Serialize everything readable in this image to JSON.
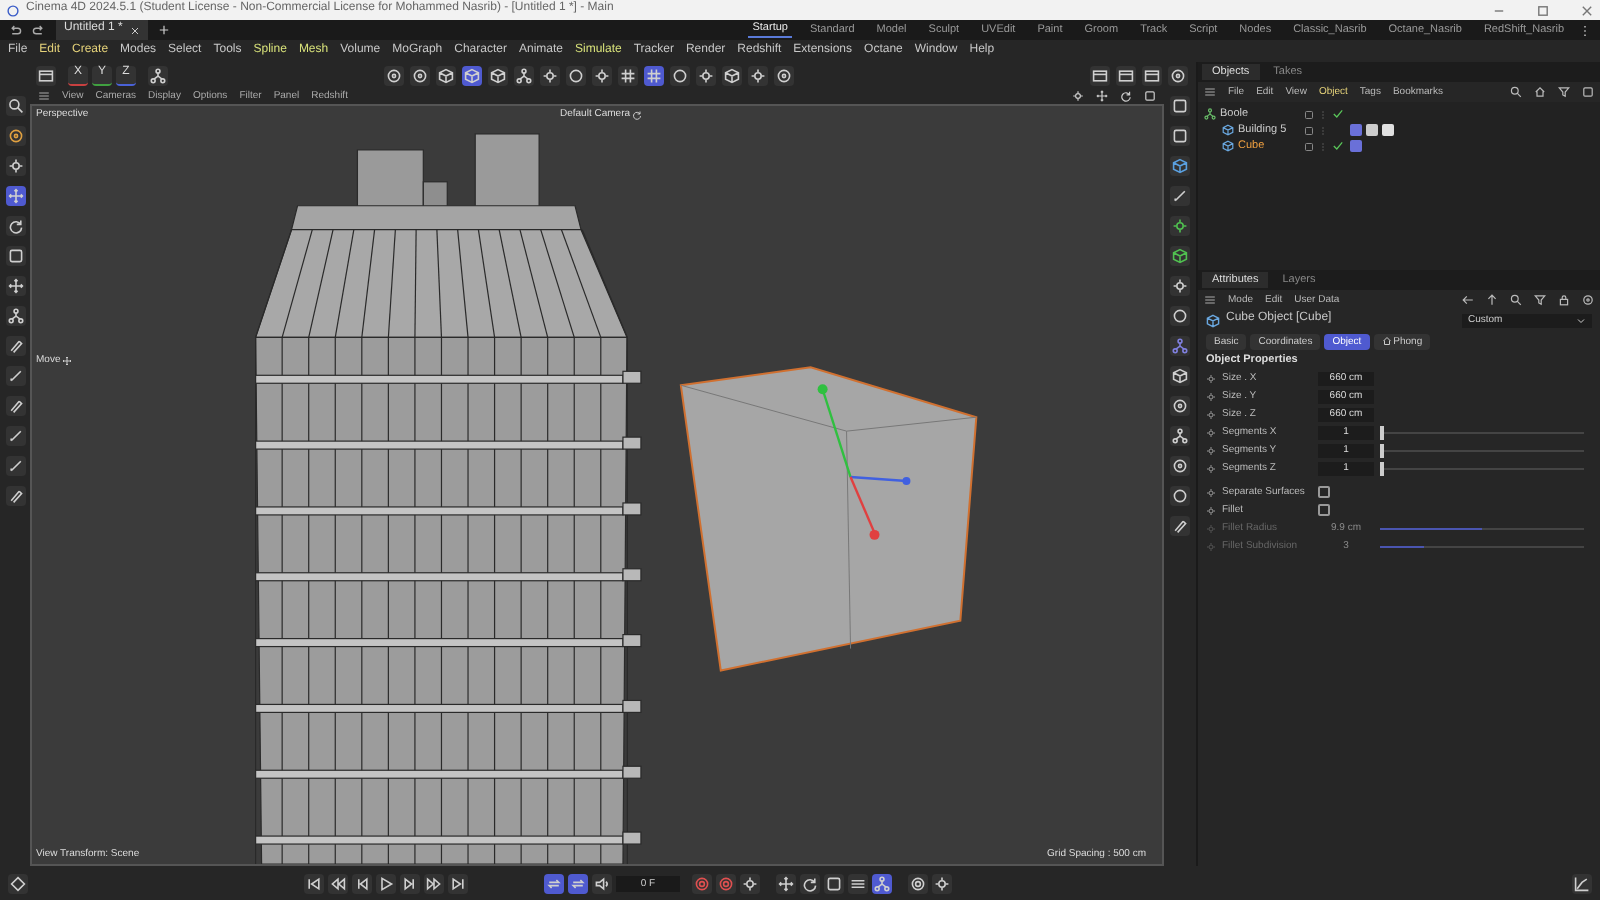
{
  "window": {
    "title": "Cinema 4D 2024.5.1 (Student License - Non-Commercial License for Mohammed Nasrib) - [Untitled 1 *] - Main"
  },
  "document_tabs": [
    {
      "label": "Untitled 1 *",
      "selected": true
    }
  ],
  "layouts": [
    {
      "label": "Startup",
      "selected": true
    },
    {
      "label": "Standard",
      "selected": false
    },
    {
      "label": "Model",
      "selected": false
    },
    {
      "label": "Sculpt",
      "selected": false
    },
    {
      "label": "UVEdit",
      "selected": false
    },
    {
      "label": "Paint",
      "selected": false
    },
    {
      "label": "Groom",
      "selected": false
    },
    {
      "label": "Track",
      "selected": false
    },
    {
      "label": "Script",
      "selected": false
    },
    {
      "label": "Nodes",
      "selected": false
    },
    {
      "label": "Classic_Nasrib",
      "selected": false
    },
    {
      "label": "Octane_Nasrib",
      "selected": false
    },
    {
      "label": "RedShift_Nasrib",
      "selected": false
    }
  ],
  "menu": [
    {
      "label": "File",
      "color": "#c8c8c8"
    },
    {
      "label": "Edit",
      "color": "#e6d37a"
    },
    {
      "label": "Create",
      "color": "#e6d37a"
    },
    {
      "label": "Modes",
      "color": "#c8c8c8"
    },
    {
      "label": "Select",
      "color": "#c8c8c8"
    },
    {
      "label": "Tools",
      "color": "#c8c8c8"
    },
    {
      "label": "Spline",
      "color": "#d8e27a"
    },
    {
      "label": "Mesh",
      "color": "#d8e27a"
    },
    {
      "label": "Volume",
      "color": "#c8c8c8"
    },
    {
      "label": "MoGraph",
      "color": "#c8c8c8"
    },
    {
      "label": "Character",
      "color": "#c8c8c8"
    },
    {
      "label": "Animate",
      "color": "#c8c8c8"
    },
    {
      "label": "Simulate",
      "color": "#d8e27a"
    },
    {
      "label": "Tracker",
      "color": "#c8c8c8"
    },
    {
      "label": "Render",
      "color": "#c8c8c8"
    },
    {
      "label": "Redshift",
      "color": "#c8c8c8"
    },
    {
      "label": "Extensions",
      "color": "#c8c8c8"
    },
    {
      "label": "Octane",
      "color": "#c8c8c8"
    },
    {
      "label": "Window",
      "color": "#c8c8c8"
    },
    {
      "label": "Help",
      "color": "#c8c8c8"
    }
  ],
  "toolbar": {
    "axes": [
      {
        "label": "X",
        "color": "#c84040"
      },
      {
        "label": "Y",
        "color": "#40a040"
      },
      {
        "label": "Z",
        "color": "#4a62d8"
      }
    ],
    "groups": [
      {
        "buttons": [
          {
            "active": false
          }
        ]
      },
      {
        "buttons": [
          {
            "active": false
          }
        ]
      },
      {
        "buttons": [
          {
            "active": false
          },
          {
            "active": false
          },
          {
            "active": false
          },
          {
            "active": true
          },
          {
            "active": false
          },
          {
            "active": false
          },
          {
            "active": false
          },
          {
            "active": false
          },
          {
            "active": false
          },
          {
            "active": false
          },
          {
            "active": true
          },
          {
            "active": false
          },
          {
            "active": false
          },
          {
            "active": false
          },
          {
            "active": false
          },
          {
            "active": false
          }
        ]
      },
      {
        "buttons": [
          {
            "active": false
          },
          {
            "active": false
          },
          {
            "active": false
          },
          {
            "active": false
          }
        ]
      }
    ]
  },
  "left_tools": [
    {
      "active": false
    },
    {
      "active": false
    },
    {
      "active": false
    },
    {
      "active": true
    },
    {
      "active": false
    },
    {
      "active": false
    },
    {
      "active": false
    },
    {
      "active": false
    },
    {
      "active": false
    },
    {
      "active": false
    },
    {
      "active": false
    },
    {
      "active": false
    },
    {
      "active": false
    },
    {
      "active": false
    }
  ],
  "viewport": {
    "menu": [
      "View",
      "Cameras",
      "Display",
      "Options",
      "Filter",
      "Panel",
      "Redshift"
    ],
    "view_name": "Perspective",
    "camera": "Default Camera",
    "tool": "Move",
    "view_transform": "View Transform: Scene",
    "grid_spacing": "Grid Spacing : 500 cm"
  },
  "right_strip": [
    {
      "active": false
    },
    {
      "active": false
    },
    {
      "active": false
    },
    {
      "active": false
    },
    {
      "active": false
    },
    {
      "active": false
    },
    {
      "active": false
    },
    {
      "active": false
    },
    {
      "active": false
    },
    {
      "active": false
    },
    {
      "active": false
    },
    {
      "active": false
    },
    {
      "active": false
    },
    {
      "active": false
    },
    {
      "active": false
    }
  ],
  "objects_panel": {
    "tabs": [
      {
        "label": "Objects",
        "selected": true
      },
      {
        "label": "Takes",
        "selected": false
      }
    ],
    "menu": [
      {
        "label": "File",
        "selected": false
      },
      {
        "label": "Edit",
        "selected": false
      },
      {
        "label": "View",
        "selected": false
      },
      {
        "label": "Object",
        "selected": true
      },
      {
        "label": "Tags",
        "selected": false
      },
      {
        "label": "Bookmarks",
        "selected": false
      }
    ],
    "tree": [
      {
        "name": "Boole",
        "selected": false,
        "checked": true,
        "children": [
          {
            "name": "Building 5",
            "selected": false,
            "checked": false,
            "tags": [
              {
                "kind": "phong"
              },
              {
                "kind": "uvw"
              },
              {
                "kind": "material"
              }
            ]
          },
          {
            "name": "Cube",
            "selected": true,
            "checked": true,
            "tags": [
              {
                "kind": "phong"
              }
            ]
          }
        ]
      }
    ]
  },
  "attributes_panel": {
    "tabs": [
      {
        "label": "Attributes",
        "selected": true
      },
      {
        "label": "Layers",
        "selected": false
      }
    ],
    "menu": [
      "Mode",
      "Edit",
      "User Data"
    ],
    "object_title": "Cube Object [Cube]",
    "preset": "Custom",
    "sub_tabs": [
      {
        "label": "Basic",
        "selected": false
      },
      {
        "label": "Coordinates",
        "selected": false
      },
      {
        "label": "Object",
        "selected": true
      },
      {
        "label": "Phong",
        "selected": false
      }
    ],
    "section": "Object Properties",
    "fields": [
      {
        "kind": "number",
        "label": "Size . X",
        "value": "660 cm",
        "disabled": false
      },
      {
        "kind": "number",
        "label": "Size . Y",
        "value": "660 cm",
        "disabled": false
      },
      {
        "kind": "number",
        "label": "Size . Z",
        "value": "660 cm",
        "disabled": false
      },
      {
        "kind": "slider",
        "label": "Segments X",
        "value": "1",
        "level": 0,
        "disabled": false
      },
      {
        "kind": "slider",
        "label": "Segments Y",
        "value": "1",
        "level": 0,
        "disabled": false
      },
      {
        "kind": "slider",
        "label": "Segments Z",
        "value": "1",
        "level": 0,
        "disabled": false
      },
      {
        "kind": "checkbox",
        "label": "Separate Surfaces",
        "checked": false,
        "disabled": false
      },
      {
        "kind": "checkbox",
        "label": "Fillet",
        "checked": false,
        "disabled": false
      },
      {
        "kind": "slider",
        "label": "Fillet Radius",
        "value": "9.9 cm",
        "level": 0.5,
        "disabled": true
      },
      {
        "kind": "slider",
        "label": "Fillet Subdivision",
        "value": "3",
        "level": 0.22,
        "disabled": true
      }
    ]
  },
  "timeline": {
    "frame": "0 F",
    "buttons": [
      {
        "active": false
      },
      {
        "active": false
      },
      {
        "active": false
      },
      {
        "active": false
      },
      {
        "active": false
      },
      {
        "active": false
      },
      {
        "active": false
      },
      {
        "active": false
      },
      {
        "active": true
      },
      {
        "active": true
      },
      {
        "active": false
      },
      {
        "active": false
      },
      {
        "active": false
      },
      {
        "active": false
      },
      {
        "active": false
      },
      {
        "active": false
      },
      {
        "active": false
      },
      {
        "active": false
      },
      {
        "active": true
      },
      {
        "active": false
      },
      {
        "active": false
      },
      {
        "active": false
      }
    ]
  }
}
